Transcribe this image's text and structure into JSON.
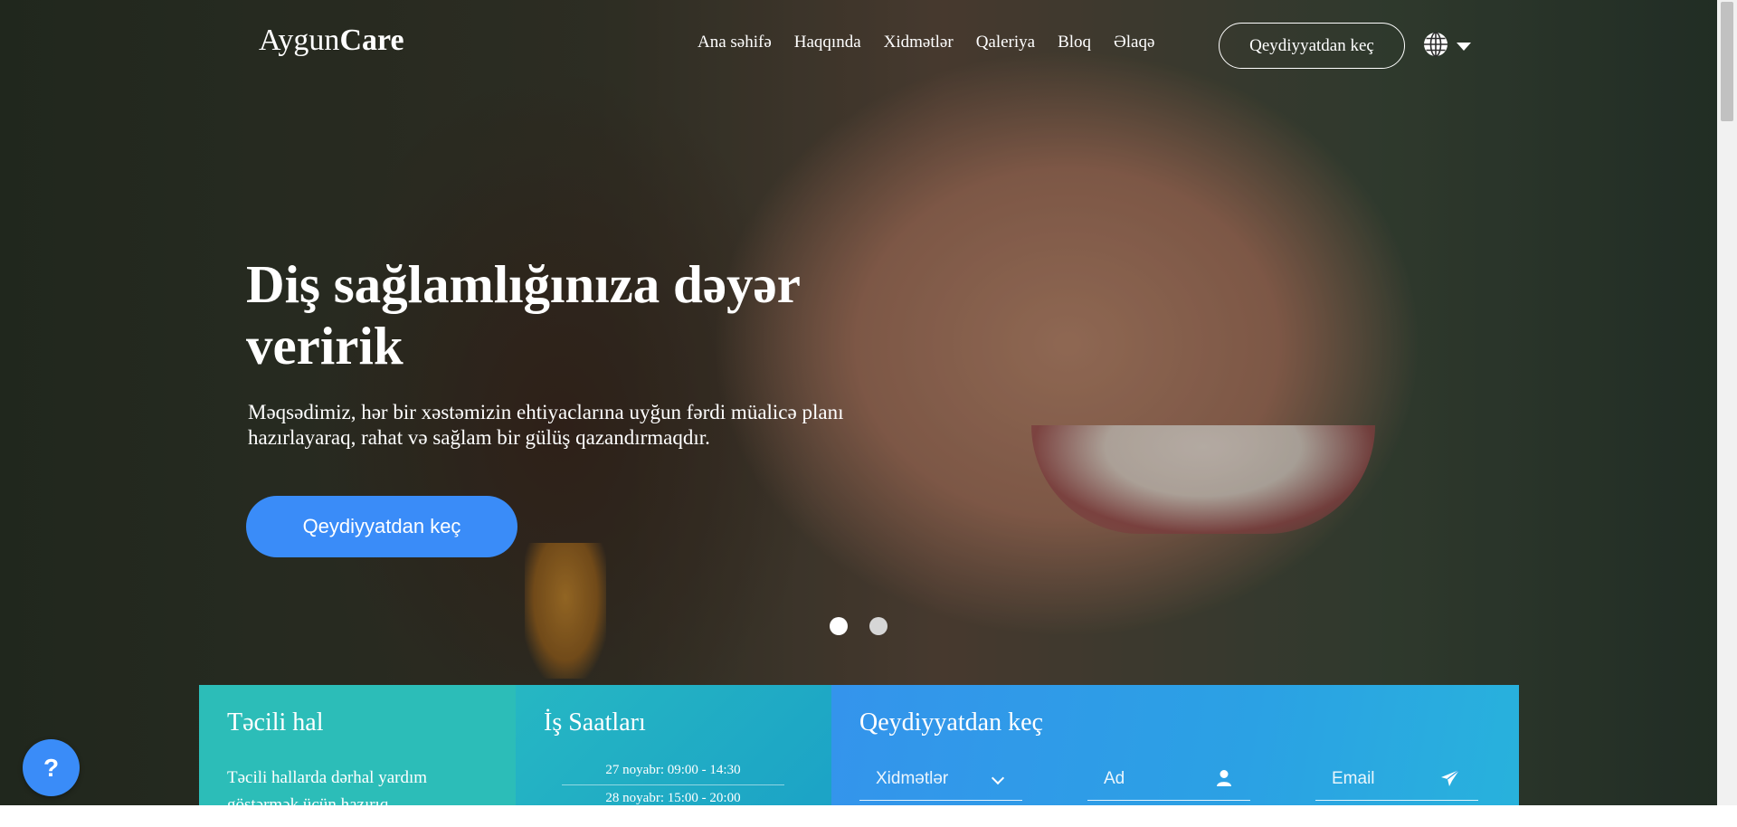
{
  "brand": {
    "logo_light": "Aygun",
    "logo_bold": "Care"
  },
  "nav": {
    "items": [
      {
        "label": "Ana səhifə"
      },
      {
        "label": "Haqqında"
      },
      {
        "label": "Xidmətlər"
      },
      {
        "label": "Qaleriya"
      },
      {
        "label": "Bloq"
      },
      {
        "label": "Əlaqə"
      }
    ],
    "cta_label": "Qeydiyyatdan keç",
    "language_icon": "globe-icon"
  },
  "hero": {
    "title": "Diş sağlamlığınıza dəyər veririk",
    "subtitle": "Məqsədimiz, hər bir xəstəmizin ehtiyaclarına uyğun fərdi müalicə planı hazırlayaraq, rahat və sağlam bir gülüş qazandırmaqdır.",
    "button_label": "Qeydiyyatdan keç",
    "slides_count": 2,
    "active_slide": 1
  },
  "emergency": {
    "title": "Təcili hal",
    "text": "Təcili hallarda dərhal yardım göstərmək üçün hazırıq"
  },
  "hours": {
    "title": "İş Saatları",
    "rows": [
      {
        "text": "27 noyabr: 09:00 - 14:30"
      },
      {
        "text": "28 noyabr: 15:00 - 20:00"
      }
    ]
  },
  "register": {
    "title": "Qeydiyyatdan keç",
    "service_select": "Xidmətlər",
    "name_placeholder": "Ad",
    "email_placeholder": "Email"
  },
  "help_button": {
    "label": "?"
  },
  "colors": {
    "accent_blue": "#3a8cf8",
    "teal": "#2cbdb8",
    "register_gradient_start": "#3494ec"
  }
}
